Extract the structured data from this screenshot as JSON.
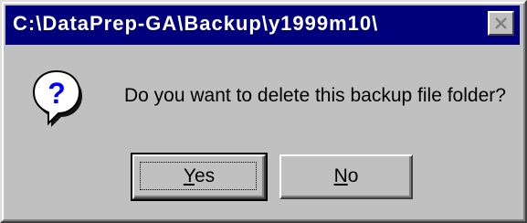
{
  "window": {
    "title": "C:\\DataPrep-GA\\Backup\\y1999m10\\",
    "close_icon": "close-icon"
  },
  "message": {
    "icon": "question-icon",
    "text": "Do you want to delete this backup file folder?"
  },
  "buttons": {
    "yes": {
      "mnemonic": "Y",
      "rest": "es"
    },
    "no": {
      "mnemonic": "N",
      "rest": "o"
    }
  },
  "colors": {
    "titlebar": "#00007c",
    "dialog_face": "#c0c0c0",
    "icon_blue": "#0000ff"
  }
}
